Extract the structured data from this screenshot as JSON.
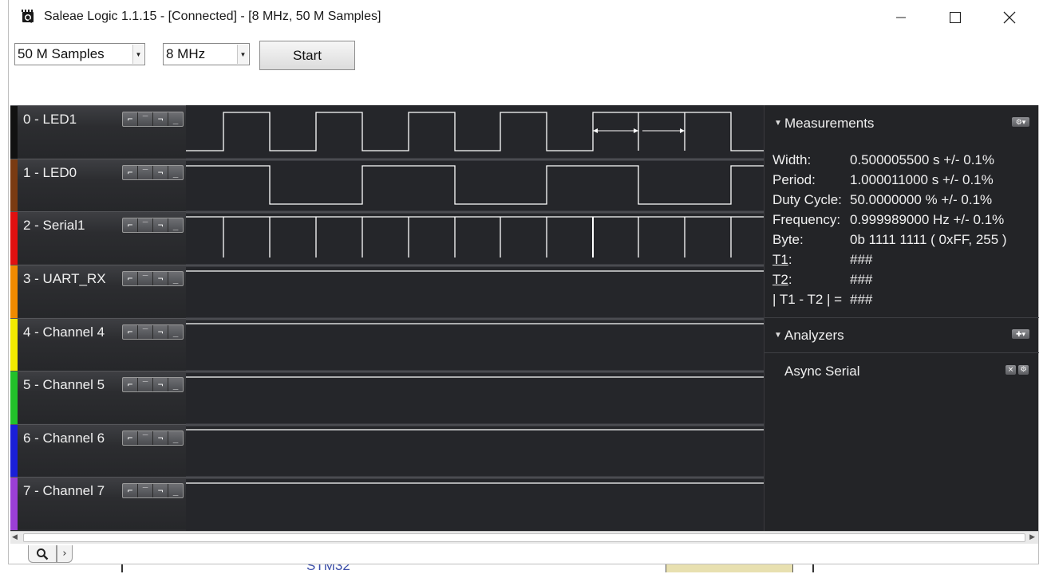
{
  "window": {
    "title": "Saleae Logic 1.1.15 - [Connected] - [8 MHz, 50 M Samples]"
  },
  "toolbar": {
    "samples_value": "50 M Samples",
    "rate_value": "8 MHz",
    "start_label": "Start"
  },
  "channels": [
    {
      "label": "0 - LED1",
      "color": "#111111"
    },
    {
      "label": "1 - LED0",
      "color": "#7a3b12"
    },
    {
      "label": "2 - Serial1",
      "color": "#e01010"
    },
    {
      "label": "3 - UART_RX",
      "color": "#f08a00"
    },
    {
      "label": "4 - Channel 4",
      "color": "#f2ea00"
    },
    {
      "label": "5 - Channel 5",
      "color": "#22c12a"
    },
    {
      "label": "6 - Channel 6",
      "color": "#1a1fd8"
    },
    {
      "label": "7 - Channel 7",
      "color": "#9b3fd6"
    }
  ],
  "measurements": {
    "title": "Measurements",
    "width_label": "Width:",
    "width_value": "0.500005500 s +/- 0.1%",
    "period_label": "Period:",
    "period_value": "1.000011000 s +/- 0.1%",
    "duty_label": "Duty Cycle:",
    "duty_value": "50.0000000 % +/- 0.1%",
    "freq_label": "Frequency:",
    "freq_value": "0.999989000 Hz +/- 0.1%",
    "byte_label": "Byte:",
    "byte_value": "0b  1111  1111 ( 0xFF, 255 )",
    "t1_label": "T1",
    "t1_value": "###",
    "t2_label": "T2",
    "t2_value": "###",
    "diff_label": "| T1 - T2 | =",
    "diff_value": "###"
  },
  "analyzers": {
    "title": "Analyzers",
    "items": [
      "Async Serial"
    ]
  },
  "background": {
    "partial_text": "STM32"
  }
}
